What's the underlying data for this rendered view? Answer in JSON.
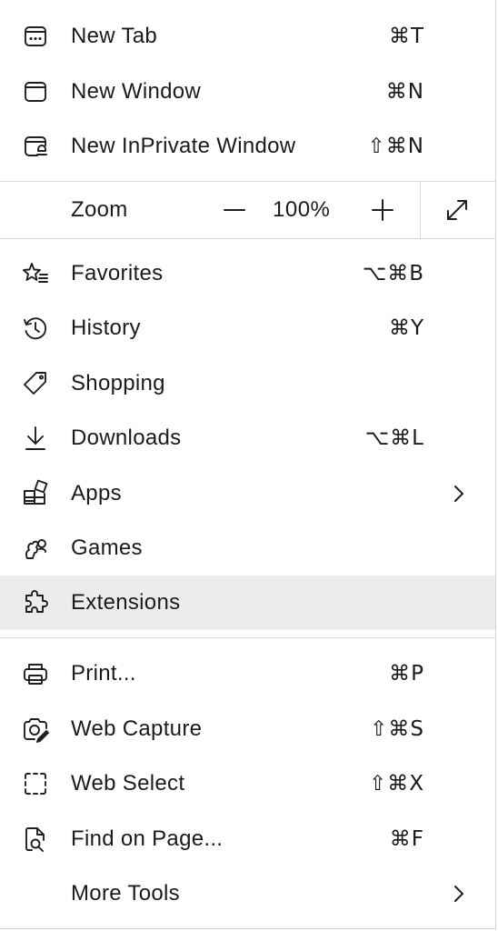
{
  "menu": {
    "new_tab": {
      "label": "New Tab",
      "shortcut": "⌘T",
      "icon": "new-tab-icon"
    },
    "new_window": {
      "label": "New Window",
      "shortcut": "⌘N",
      "icon": "new-window-icon"
    },
    "new_inprivate": {
      "label": "New InPrivate Window",
      "shortcut": "⇧⌘N",
      "icon": "inprivate-icon"
    },
    "zoom": {
      "label": "Zoom",
      "value": "100%",
      "decrease_icon": "minus-icon",
      "increase_icon": "plus-icon",
      "fullscreen_icon": "fullscreen-icon"
    },
    "favorites": {
      "label": "Favorites",
      "shortcut": "⌥⌘B",
      "icon": "favorites-icon"
    },
    "history": {
      "label": "History",
      "shortcut": "⌘Y",
      "icon": "history-icon"
    },
    "shopping": {
      "label": "Shopping",
      "icon": "shopping-tag-icon"
    },
    "downloads": {
      "label": "Downloads",
      "shortcut": "⌥⌘L",
      "icon": "download-icon"
    },
    "apps": {
      "label": "Apps",
      "icon": "apps-icon",
      "submenu_icon": "chevron-right-icon"
    },
    "games": {
      "label": "Games",
      "icon": "games-icon"
    },
    "extensions": {
      "label": "Extensions",
      "icon": "extensions-icon",
      "highlighted": true
    },
    "print": {
      "label": "Print...",
      "shortcut": "⌘P",
      "icon": "print-icon"
    },
    "web_capture": {
      "label": "Web Capture",
      "shortcut": "⇧⌘S",
      "icon": "web-capture-icon"
    },
    "web_select": {
      "label": "Web Select",
      "shortcut": "⇧⌘X",
      "icon": "web-select-icon"
    },
    "find_on_page": {
      "label": "Find on Page...",
      "shortcut": "⌘F",
      "icon": "find-on-page-icon"
    },
    "more_tools": {
      "label": "More Tools",
      "submenu_icon": "chevron-right-icon"
    }
  },
  "colors": {
    "highlight": "#ececec",
    "divider": "#d9d9d9",
    "text": "#1b1b1b"
  }
}
